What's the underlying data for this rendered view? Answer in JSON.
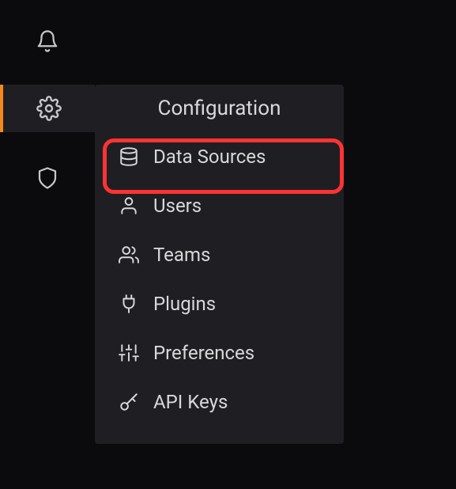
{
  "flyout": {
    "title": "Configuration",
    "items": [
      {
        "label": "Data Sources",
        "icon": "database-icon"
      },
      {
        "label": "Users",
        "icon": "user-icon"
      },
      {
        "label": "Teams",
        "icon": "users-icon"
      },
      {
        "label": "Plugins",
        "icon": "plug-icon"
      },
      {
        "label": "Preferences",
        "icon": "sliders-icon"
      },
      {
        "label": "API Keys",
        "icon": "key-icon"
      }
    ]
  },
  "sidebar": {
    "icons": [
      {
        "name": "bell-icon",
        "active": false
      },
      {
        "name": "gear-icon",
        "active": true
      },
      {
        "name": "shield-icon",
        "active": false
      }
    ]
  },
  "highlight": {
    "item_index": 0
  }
}
